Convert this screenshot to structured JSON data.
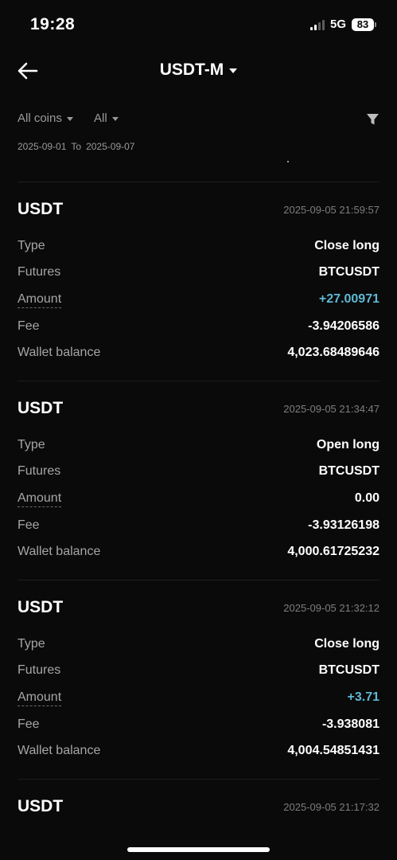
{
  "status_bar": {
    "time": "19:28",
    "network": "5G",
    "battery": "83"
  },
  "header": {
    "title": "USDT-M",
    "back_icon": "arrow-left-icon",
    "caret_icon": "caret-down-icon"
  },
  "filters": {
    "coin": "All coins",
    "type": "All",
    "filter_icon": "funnel-icon",
    "date_from": "2025-09-01",
    "date_to_label": "To",
    "date_to": "2025-09-07"
  },
  "colors": {
    "background": "#0a0a0a",
    "positive": "#5fb8d4",
    "muted": "#a6a6a6"
  },
  "records": [
    {
      "coin": "USDT",
      "time": "2025-09-05 21:59:57",
      "type_label": "Type",
      "type": "Close long",
      "futures_label": "Futures",
      "futures": "BTCUSDT",
      "amount_label": "Amount",
      "amount": "+27.00971",
      "fee_label": "Fee",
      "fee": "-3.94206586",
      "balance_label": "Wallet balance",
      "balance": "4,023.68489646"
    },
    {
      "coin": "USDT",
      "time": "2025-09-05 21:34:47",
      "type_label": "Type",
      "type": "Open long",
      "futures_label": "Futures",
      "futures": "BTCUSDT",
      "amount_label": "Amount",
      "amount": "0.00",
      "fee_label": "Fee",
      "fee": "-3.93126198",
      "balance_label": "Wallet balance",
      "balance": "4,000.61725232"
    },
    {
      "coin": "USDT",
      "time": "2025-09-05 21:32:12",
      "type_label": "Type",
      "type": "Close long",
      "futures_label": "Futures",
      "futures": "BTCUSDT",
      "amount_label": "Amount",
      "amount": "+3.71",
      "fee_label": "Fee",
      "fee": "-3.938081",
      "balance_label": "Wallet balance",
      "balance": "4,004.54851431"
    },
    {
      "coin": "USDT",
      "time": "2025-09-05 21:17:32"
    }
  ]
}
